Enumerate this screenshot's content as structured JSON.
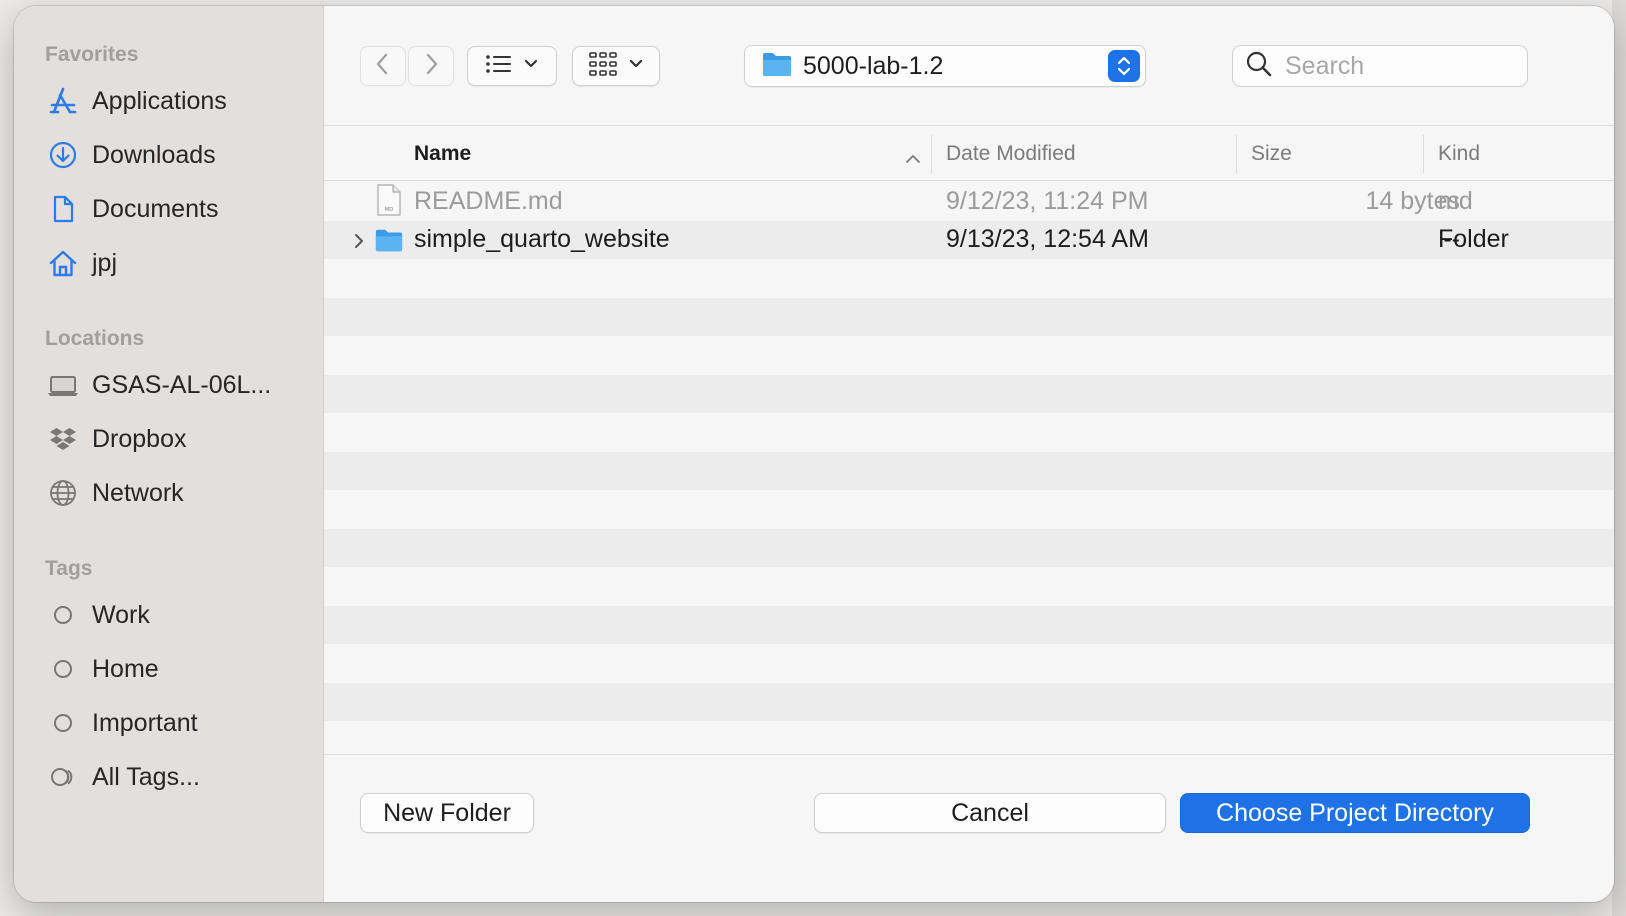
{
  "sidebar": {
    "favorites_header": "Favorites",
    "favorites": [
      {
        "label": "Applications",
        "icon": "applications-icon"
      },
      {
        "label": "Downloads",
        "icon": "downloads-icon"
      },
      {
        "label": "Documents",
        "icon": "documents-icon"
      },
      {
        "label": "jpj",
        "icon": "home-icon"
      }
    ],
    "locations_header": "Locations",
    "locations": [
      {
        "label": "GSAS-AL-06L...",
        "icon": "laptop-icon"
      },
      {
        "label": "Dropbox",
        "icon": "dropbox-icon"
      },
      {
        "label": "Network",
        "icon": "globe-icon"
      }
    ],
    "tags_header": "Tags",
    "tags": [
      {
        "label": "Work",
        "icon": "tag-circle-icon"
      },
      {
        "label": "Home",
        "icon": "tag-circle-icon"
      },
      {
        "label": "Important",
        "icon": "tag-circle-icon"
      },
      {
        "label": "All Tags...",
        "icon": "all-tags-icon"
      }
    ]
  },
  "toolbar": {
    "location": "5000-lab-1.2",
    "search_placeholder": "Search",
    "accent_color": "#1f72e6"
  },
  "columns": {
    "name": "Name",
    "date_modified": "Date Modified",
    "size": "Size",
    "kind": "Kind"
  },
  "files": [
    {
      "name": "README.md",
      "date": "9/12/23, 11:24 PM",
      "size": "14 bytes",
      "kind": "md",
      "type": "file",
      "enabled": false
    },
    {
      "name": "simple_quarto_website",
      "date": "9/13/23, 12:54 AM",
      "size": "--",
      "kind": "Folder",
      "type": "folder",
      "enabled": true
    }
  ],
  "footer": {
    "new_folder": "New Folder",
    "cancel": "Cancel",
    "choose": "Choose Project Directory"
  }
}
